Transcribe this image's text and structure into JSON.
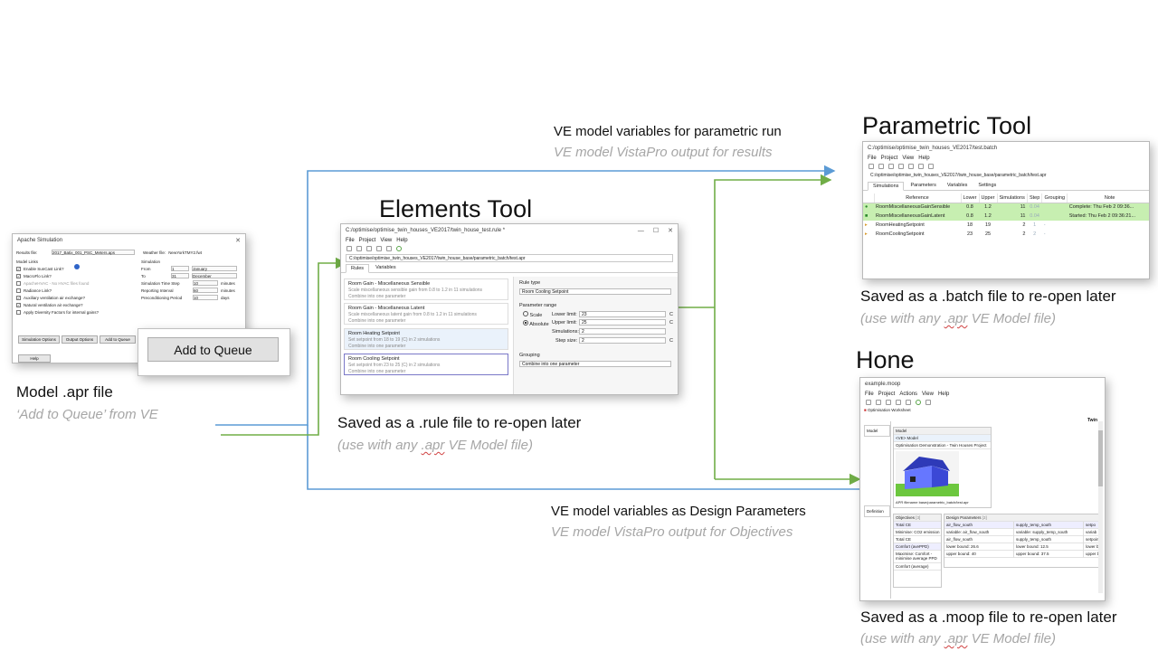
{
  "captions": {
    "model_title": "Model .apr file",
    "model_sub": "‘Add to Queue’ from VE",
    "elements_title": "Elements Tool",
    "elements_saved": "Saved as a .rule file to re-open later",
    "elements_use_pre": "(use with any ",
    "elements_use_apr": ".apr",
    "elements_use_post": " VE Model file)",
    "parametric_title": "Parametric Tool",
    "parametric_saved": "Saved as a .batch file to re-open later",
    "parametric_use_pre": "(use with any ",
    "parametric_use_apr": ".apr",
    "parametric_use_post": " VE Model file)",
    "hone_title": "Hone",
    "hone_saved": "Saved as a .moop file to re-open later",
    "hone_use_pre": "(use with any ",
    "hone_use_apr": ".apr",
    "hone_use_post": " VE Model file)",
    "top_flow": "VE model variables for parametric run",
    "top_flow_sub": "VE model VistaPro output for results",
    "bottom_flow": "VE model variables as Design Parameters",
    "bottom_flow_sub": "VE model VistaPro output for Objectives"
  },
  "colors": {
    "blue_arrow": "#5b9bd5",
    "green_arrow": "#70ad47",
    "caption_gray": "#a6a6a6"
  },
  "apache": {
    "title": "Apache Simulation",
    "results_label": "Results file:",
    "results_value": "2017_Batix_001_PSC_Meters.aps",
    "weather_label": "Weather file:",
    "weather_value": "NewYorkTMY2.fwt",
    "model_links": "Model Links",
    "simulation": "Simulation",
    "checks": [
      "Enable SunCast Link?",
      "MacroFlo Link?",
      "ApacheHVAC - No HVAC files found",
      "Radiance Link?",
      "Auxiliary ventilation air exchange?",
      "Natural ventilation air exchange?",
      "Apply Diversity Factors for internal gains?"
    ],
    "from_label": "From",
    "from_day": "1",
    "from_month": "January",
    "to_label": "To",
    "to_day": "31",
    "to_month": "December",
    "timestep_label": "Simulation Time Step",
    "timestep_value": "10",
    "timestep_unit": "minutes",
    "reporting_label": "Reporting Interval",
    "reporting_value": "60",
    "reporting_unit": "minutes",
    "precond_label": "Preconditioning Period",
    "precond_value": "10",
    "precond_unit": "days",
    "sim_options_btn": "Simulation Options",
    "output_options_btn": "Output Options",
    "add_queue_small_btn": "Add to Queue",
    "help_btn": "Help",
    "add_queue_btn": "Add to Queue"
  },
  "elements": {
    "title": "C:/optimise/optimise_twin_houses_VE2017/twin_house_test.rule *",
    "menu": [
      "File",
      "Project",
      "View",
      "Help"
    ],
    "path": "C:/optimise/optimise_twin_houses_VE2017/twin_house_base/parametric_batch/test.apr",
    "tabs": [
      "Rules",
      "Variables"
    ],
    "rules": [
      {
        "title": "Room Gain - Miscellaneous Sensible",
        "sub1": "Scale miscellaneous sensible gain from 0.8 to 1.2 in 11 simulations",
        "sub2": "Combine into one parameter"
      },
      {
        "title": "Room Gain - Miscellaneous Latent",
        "sub1": "Scale miscellaneous latent gain from 0.8 to 1.2 in 11 simulations",
        "sub2": "Combine into one parameter"
      },
      {
        "title": "Room Heating Setpoint",
        "sub1": "Set setpoint from 18 to 19 (C) in 2 simulations",
        "sub2": "Combine into one parameter"
      },
      {
        "title": "Room Cooling Setpoint",
        "sub1": "Set setpoint from 23 to 25 (C) in 2 simulations",
        "sub2": "Combine into one parameter"
      }
    ],
    "rule_type_label": "Rule type",
    "rule_type_value": "Room Cooling Setpoint",
    "param_range_label": "Parameter range",
    "scale_label": "Scale",
    "absolute_label": "Absolute",
    "lower_label": "Lower limit:",
    "lower_value": "23",
    "upper_label": "Upper limit:",
    "upper_value": "25",
    "sims_label": "Simulations:",
    "sims_value": "2",
    "step_label": "Step size:",
    "step_value": "2",
    "unit_c": "C",
    "grouping_label": "Grouping",
    "grouping_value": "Combine into one parameter"
  },
  "parametric": {
    "title": "C:/optimise/optimise_twin_houses_VE2017/test.batch",
    "menu": [
      "File",
      "Project",
      "View",
      "Help"
    ],
    "path": "C:/optimise/optimise_twin_houses_VE2017/twin_house_base/parametric_batch/test.apr",
    "tabs": [
      "Simulations",
      "Parameters",
      "Variables",
      "Settings"
    ],
    "headers": [
      "Reference",
      "Lower",
      "Upper",
      "Simulations",
      "Step",
      "Grouping",
      "Note"
    ],
    "rows": [
      {
        "ref": "RoomMiscellaneousGainSensible",
        "lower": "0.8",
        "upper": "1.2",
        "sims": "11",
        "step": "0.04",
        "group": "",
        "note": "Complete: Thu Feb 2 09:36..."
      },
      {
        "ref": "RoomMiscellaneousGainLatent",
        "lower": "0.8",
        "upper": "1.2",
        "sims": "11",
        "step": "0.04",
        "group": "",
        "note": "Started: Thu Feb 2 09:36:21..."
      },
      {
        "ref": "RoomHeatingSetpoint",
        "lower": "18",
        "upper": "19",
        "sims": "2",
        "step": "1",
        "group": "-",
        "note": ""
      },
      {
        "ref": "RoomCoolingSetpoint",
        "lower": "23",
        "upper": "25",
        "sims": "2",
        "step": "2",
        "group": "-",
        "note": ""
      }
    ]
  },
  "hone": {
    "title": "example.moop",
    "menu": [
      "File",
      "Project",
      "Actions",
      "View",
      "Help"
    ],
    "worksheet_tab": "Optimisation Worksheet",
    "twin_label": "Twin",
    "side_model": "Model",
    "side_definition": "Definition",
    "model_header": "Model",
    "model_tag": "<VE> Model",
    "model_name": "Optimisation Demonstration - Twin Houses Project",
    "apr_path": "APR filename base/parametric_batch/test.apr",
    "objectives_header": "Objectives",
    "objectives_count": "[3]",
    "design_header": "Design Parameters",
    "design_count": "[3]",
    "objectives": [
      "Total CE",
      "Minimise: CO2 emission",
      "Total CE",
      "Comfort (avePPD)",
      "Maximise: Comfort - minimise average PPD",
      "Comfort (average)"
    ],
    "dp_cols": [
      {
        "name": "air_flow_south",
        "var": "variable: air_flow_south",
        "sel": "air_flow_south",
        "lower": "lower bound: 26.6",
        "upper": "upper bound: 40"
      },
      {
        "name": "supply_temp_south",
        "var": "variable: supply_temp_south",
        "sel": "supply_temp_south",
        "lower": "lower bound: 12.5",
        "upper": "upper bound: 37.5"
      },
      {
        "name": "setpo",
        "var": "variab",
        "sel": "setpoint",
        "lower": "lower b",
        "upper": "upper b"
      }
    ]
  }
}
